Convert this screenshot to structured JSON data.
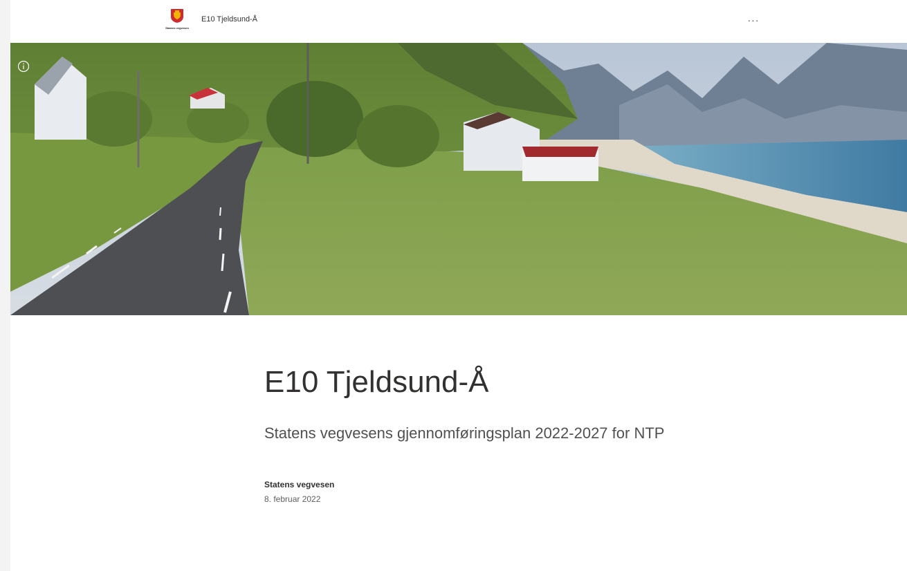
{
  "header": {
    "logo_text": "Statens vegvesen",
    "site_title": "E10 Tjeldsund-Å",
    "more_label": "···"
  },
  "hero": {
    "info_label": "i"
  },
  "article": {
    "title": "E10 Tjeldsund-Å",
    "subtitle": "Statens vegvesens gjennomføringsplan 2022-2027 for NTP",
    "author": "Statens vegvesen",
    "date": "8. februar 2022"
  },
  "colors": {
    "page_background": "#f3f3f3",
    "content_background": "#ffffff",
    "brand_red": "#d12a2f",
    "brand_yellow": "#f0b400"
  }
}
